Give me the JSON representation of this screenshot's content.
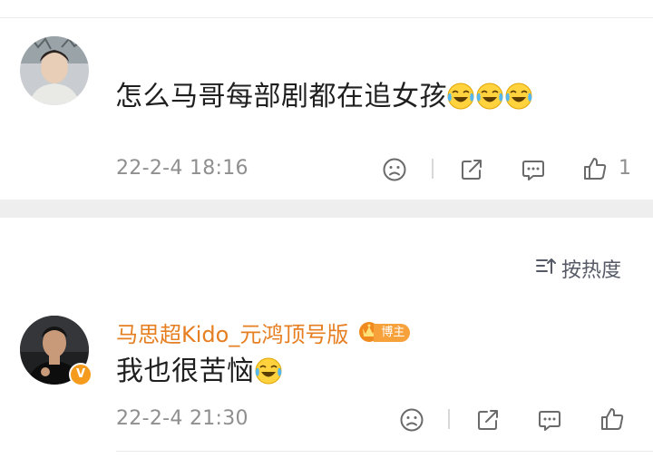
{
  "comment1": {
    "text": "怎么马哥每部剧都在追女孩",
    "emojis": [
      "laugh-cry-emoji",
      "laugh-cry-emoji",
      "laugh-cry-emoji"
    ],
    "timestamp": "22-2-4 18:16",
    "like_count": "1"
  },
  "sort": {
    "label": "按热度"
  },
  "comment2": {
    "username": "马思超Kido_元鸿顶号版",
    "badge_label": "博主",
    "verified_mark": "V",
    "text": "我也很苦恼",
    "emojis": [
      "laugh-cry-emoji"
    ],
    "timestamp": "22-2-4 21:30"
  },
  "colors": {
    "username": "#e67e22",
    "badge": "#f6a13a",
    "meta_text": "#8f8f8f",
    "divider": "#eeeeee"
  }
}
